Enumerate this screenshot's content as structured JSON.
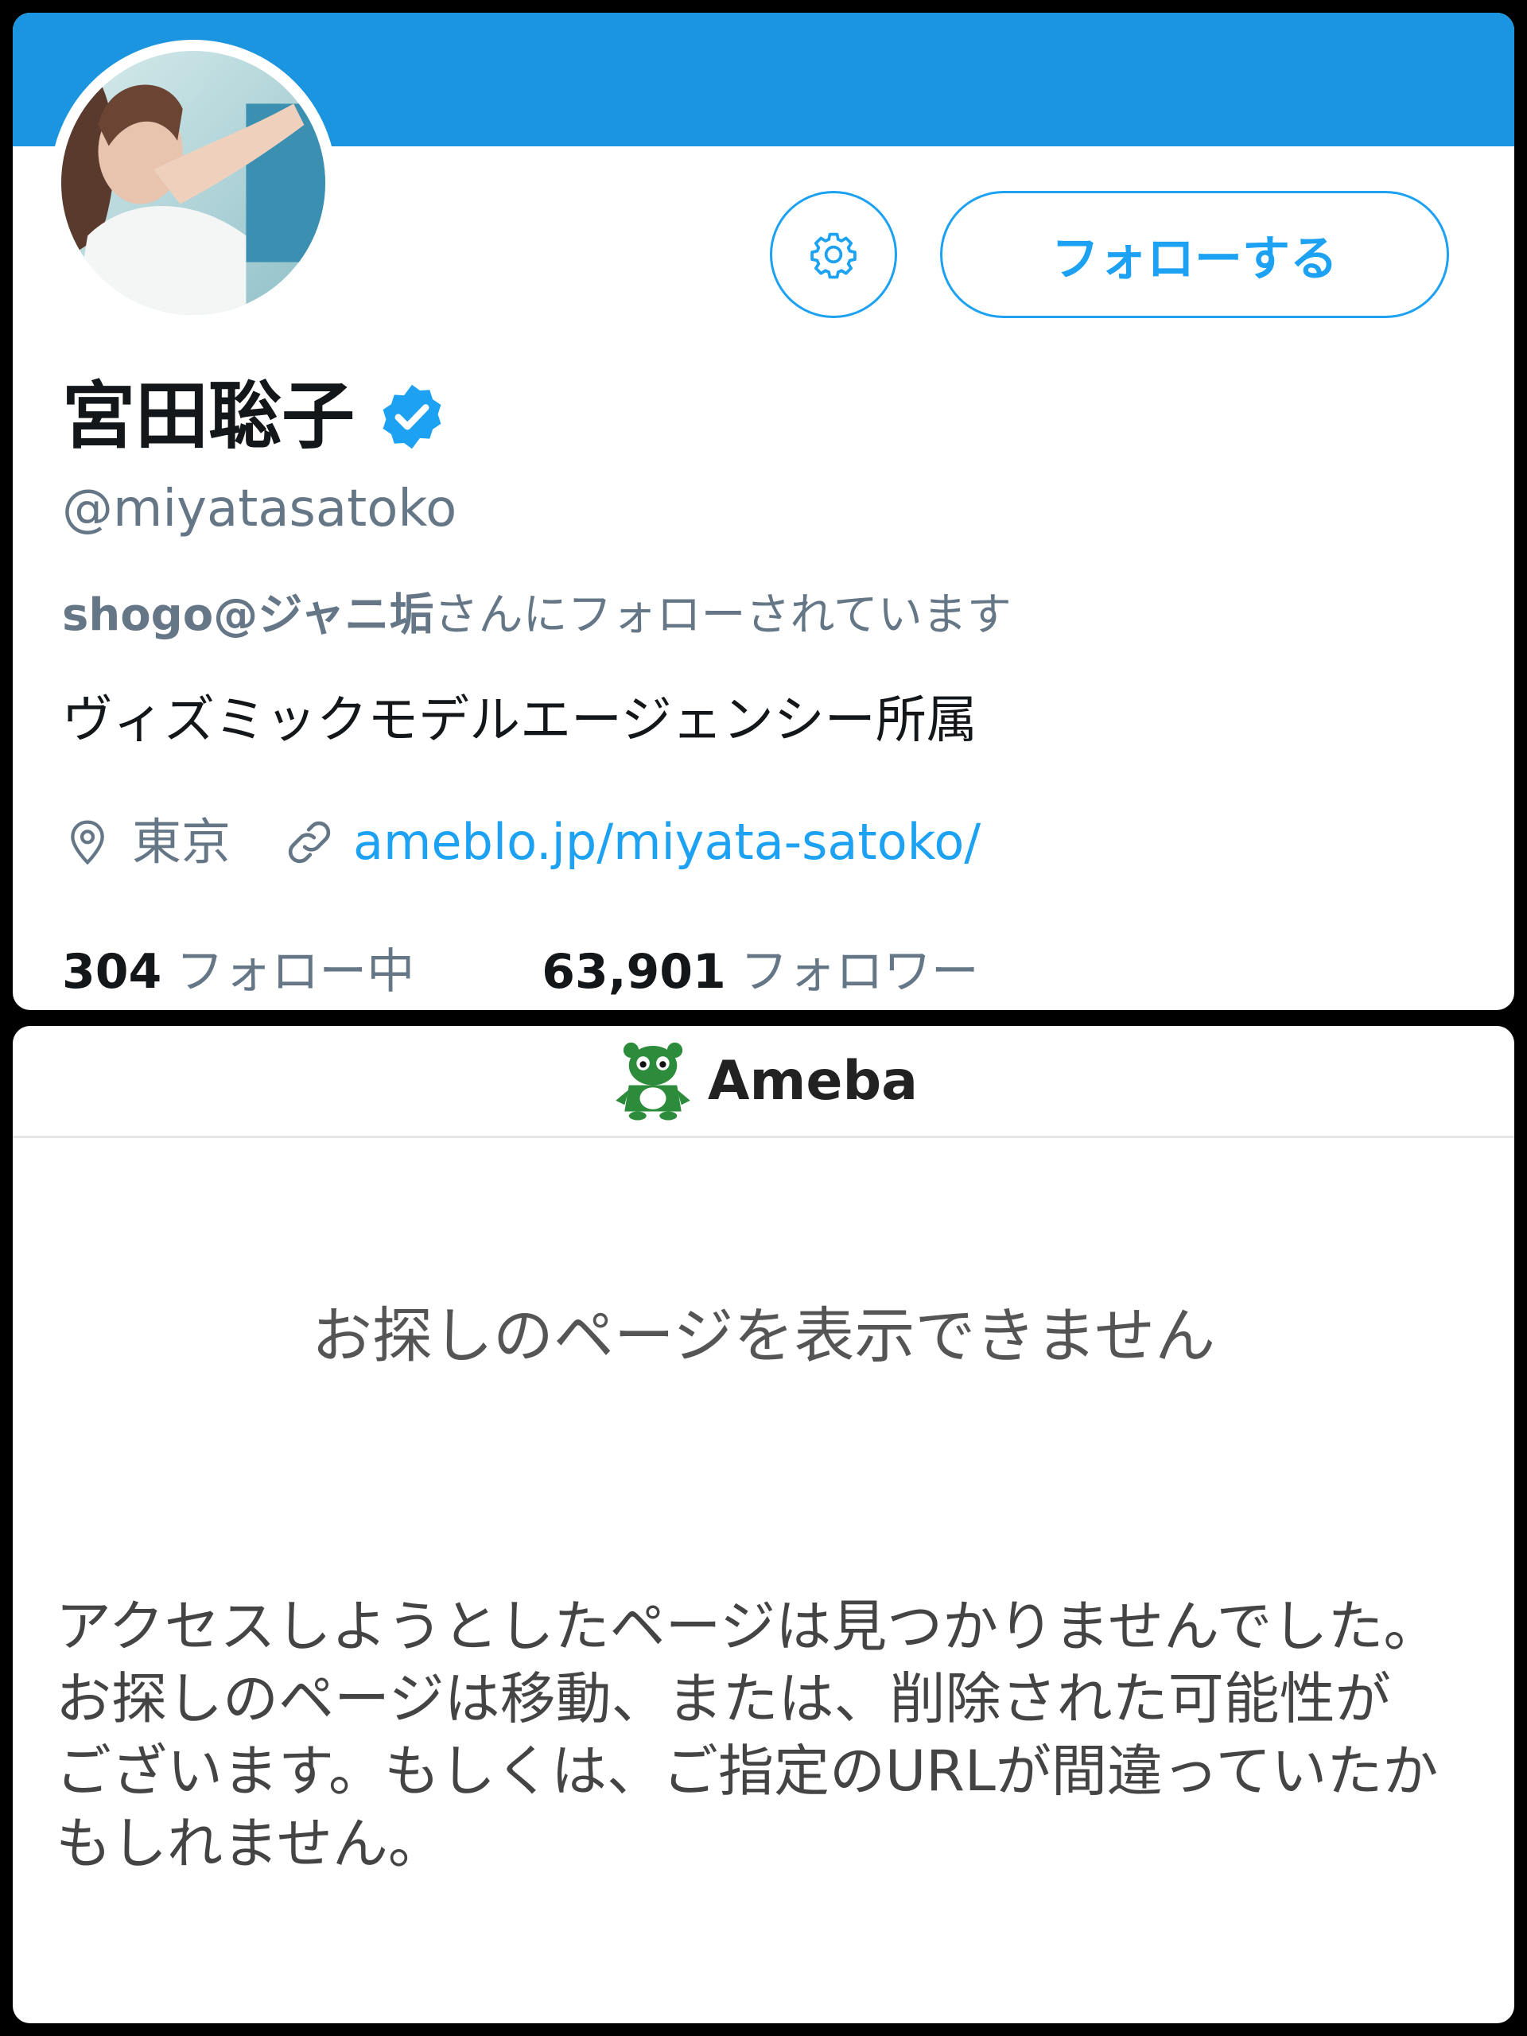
{
  "twitter": {
    "follow_button_label": "フォローする",
    "display_name": "宮田聡子",
    "handle": "@miyatasatoko",
    "followed_by_user": "shogo@ジャニ垢",
    "followed_by_suffix": "さんにフォローされています",
    "bio": "ヴィズミックモデルエージェンシー所属",
    "location": "東京",
    "website": "ameblo.jp/miyata-satoko/",
    "following_count": "304",
    "following_label": "フォロー中",
    "followers_count": "63,901",
    "followers_label": "フォロワー",
    "accent_color": "#1da1f2",
    "banner_color": "#1b95e0"
  },
  "ameba": {
    "logo_text": "Ameba",
    "error_title": "お探しのページを表示できません",
    "error_message_1": "アクセスしようとしたページは見つかりませんでした。",
    "error_message_2": "お探しのページは移動、または、削除された可能性がございます。もしくは、ご指定のURLが間違っていたかもしれません。",
    "brand_color": "#2d8c3c"
  },
  "icons": [
    "settings-gear-icon",
    "verified-badge-icon",
    "location-pin-icon",
    "link-icon",
    "ameba-mascot-icon"
  ]
}
